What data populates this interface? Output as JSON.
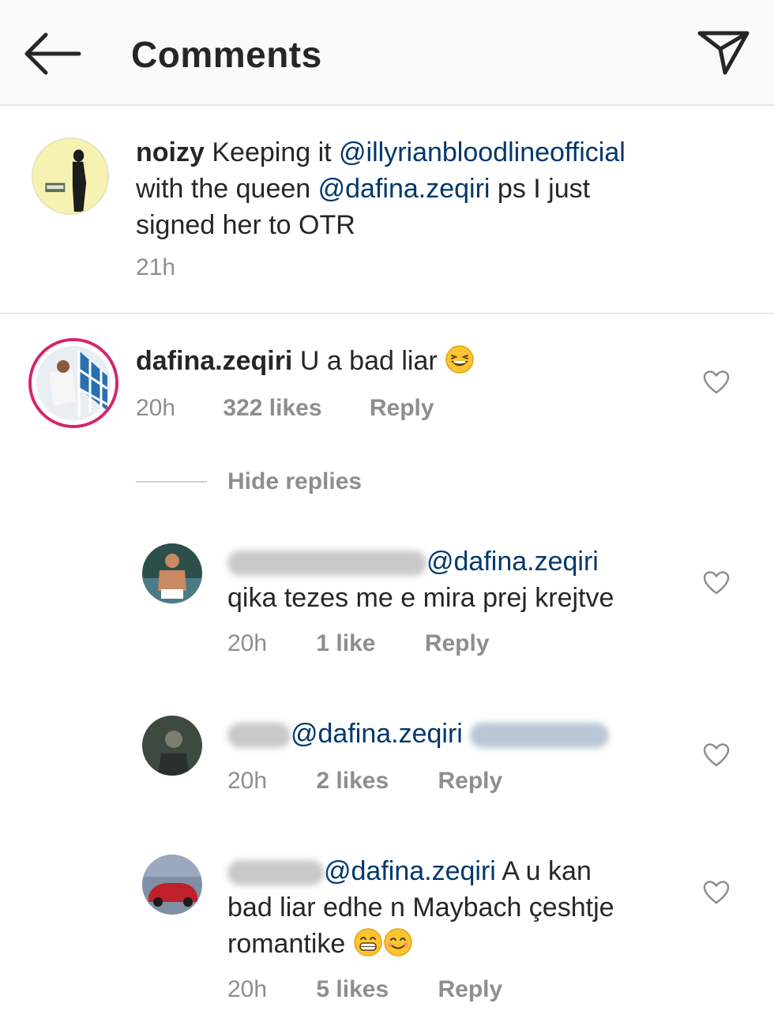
{
  "header": {
    "title": "Comments",
    "back_icon": "arrow-left-icon",
    "send_icon": "paper-plane-icon"
  },
  "caption": {
    "username": "noizy",
    "text_1": "Keeping it ",
    "mention_1": "@illyrianbloodlineofficial",
    "text_2": "with the queen ",
    "mention_2": "@dafina.zeqiri",
    "text_3": " ps I just",
    "text_4": "signed her to OTR",
    "time": "21h"
  },
  "comment": {
    "username": "dafina.zeqiri",
    "text": "U a bad liar",
    "emoji": "laughing-emoji",
    "time": "20h",
    "likes": "322 likes",
    "reply": "Reply"
  },
  "hide_replies": "Hide replies",
  "replies": [
    {
      "mention": "@dafina.zeqiri",
      "text": "qika tezes me e mira prej krejtve",
      "time": "20h",
      "likes": "1 like",
      "reply": "Reply"
    },
    {
      "mention": "@dafina.zeqiri",
      "time": "20h",
      "likes": "2 likes",
      "reply": "Reply"
    },
    {
      "mention": "@dafina.zeqiri",
      "text_1": " A u kan",
      "text_2": "bad liar edhe n Maybach çeshtje",
      "text_3": "romantike",
      "emoji": "grinning-emoji",
      "time": "20h",
      "likes": "5 likes",
      "reply": "Reply"
    }
  ],
  "colors": {
    "text": "#262626",
    "secondary": "#8e8e8e",
    "mention": "#00376b",
    "header_bg": "#fafafa",
    "story_ring": "#d6246e"
  }
}
